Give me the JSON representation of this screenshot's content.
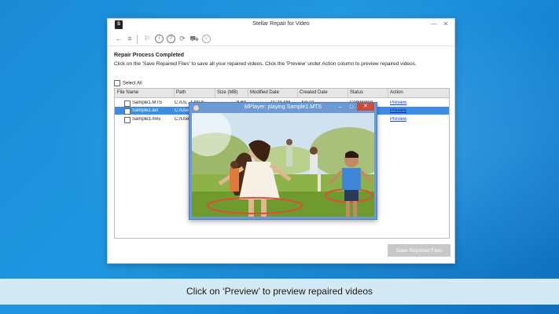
{
  "app": {
    "title": "Stellar Repair for Video",
    "logo_text": "S",
    "minimize": "—",
    "close": "✕"
  },
  "toolbar": {
    "back": "←",
    "menu": "≡",
    "icons": [
      "flag-icon",
      "info-icon",
      "help-icon",
      "refresh-icon",
      "cart-icon",
      "account-icon"
    ]
  },
  "content": {
    "heading": "Repair Process Completed",
    "description": "Click on the 'Save Repaired Files' to save all your repaired videos. Click the 'Preview' under Action column to preview repaired videos.",
    "select_all": "Select All"
  },
  "table": {
    "columns": [
      "File Name",
      "Path",
      "Size (MB)",
      "Modified Date",
      "Created Date",
      "Status",
      "Action"
    ],
    "rows": [
      {
        "file": "Sample1.MTS",
        "path": "C:/Us...1.MTS",
        "size": "8.69",
        "modified": "11:23 AM",
        "created": "Jun 01",
        "status": "Completed",
        "action": "Preview",
        "selected": false
      },
      {
        "file": "Sample2.avi",
        "path": "C:/Use",
        "size": "",
        "modified": "",
        "created": "",
        "status": "",
        "action": "Preview",
        "selected": true
      },
      {
        "file": "Sample3.mkv",
        "path": "C:/Use",
        "size": "",
        "modified": "",
        "created": "",
        "status": "",
        "action": "Preview",
        "selected": false
      }
    ]
  },
  "save_button": "Save Repaired Files",
  "mplayer": {
    "title": "MPlayer: playing Sample1.MTS",
    "minimize": "–",
    "maximize": "□",
    "close": "✕"
  },
  "caption": "Click on ‘Preview’ to preview repaired videos",
  "colors": {
    "background": "#1b8ad6",
    "selected_row": "#3d8ee3",
    "link": "#1d44c8",
    "mplayer_frame": "#6b9ad4",
    "caption_bar": "#d3eaf6"
  }
}
